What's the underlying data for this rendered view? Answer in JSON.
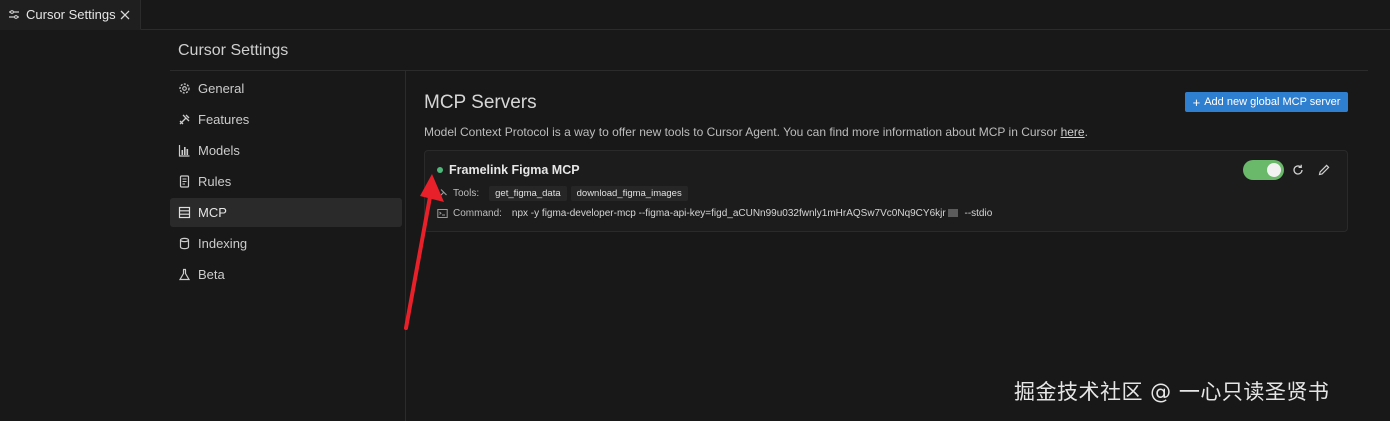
{
  "tab": {
    "title": "Cursor Settings"
  },
  "header": {
    "title": "Cursor Settings"
  },
  "sidebar": {
    "items": [
      {
        "label": "General",
        "icon": "gear-icon"
      },
      {
        "label": "Features",
        "icon": "tools-icon"
      },
      {
        "label": "Models",
        "icon": "bar-chart-icon"
      },
      {
        "label": "Rules",
        "icon": "document-icon"
      },
      {
        "label": "MCP",
        "icon": "server-icon",
        "active": true
      },
      {
        "label": "Indexing",
        "icon": "database-icon"
      },
      {
        "label": "Beta",
        "icon": "flask-icon"
      }
    ]
  },
  "main": {
    "title": "MCP Servers",
    "add_button_label": "Add new global MCP server",
    "description": "Model Context Protocol is a way to offer new tools to Cursor Agent. You can find more information about MCP in Cursor ",
    "description_link": "here",
    "description_end": "."
  },
  "server": {
    "name": "Framelink Figma MCP",
    "status_color": "#4db87a",
    "enabled": true,
    "tools_label": "Tools:",
    "tools": [
      "get_figma_data",
      "download_figma_images"
    ],
    "command_label": "Command:",
    "command_prefix": "npx -y figma-developer-mcp --figma-api-key=figd_aCUNn99u032fwnly1mHrAQSw7Vc0Nq9CY6kjr",
    "command_suffix": "--stdio"
  },
  "colors": {
    "accent": "#2f7fd1",
    "toggle_on": "#6ab86a",
    "annotation_arrow": "#e8202a"
  },
  "watermark": "掘金技术社区 @ 一心只读圣贤书"
}
